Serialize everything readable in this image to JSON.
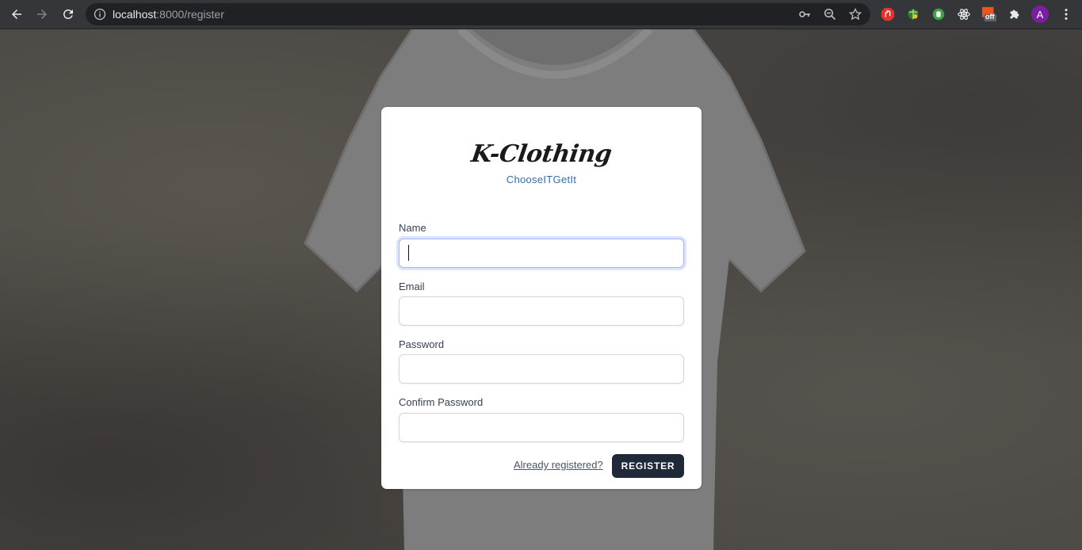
{
  "browser": {
    "url_host": "localhost",
    "url_rest": ":8000/register",
    "extension_badge": "off",
    "profile_initial": "A"
  },
  "brand": {
    "name": "K-Clothing",
    "tagline": "ChooseITGetIt"
  },
  "form": {
    "name_label": "Name",
    "name_value": "",
    "email_label": "Email",
    "email_value": "",
    "password_label": "Password",
    "password_value": "",
    "confirm_label": "Confirm Password",
    "confirm_value": "",
    "login_link": "Already registered?",
    "submit_label": "REGISTER"
  },
  "colors": {
    "card_bg": "#ffffff",
    "button_bg": "#1f2937",
    "tagline": "#2f6fb0",
    "focus_ring": "#a5b4fc"
  }
}
